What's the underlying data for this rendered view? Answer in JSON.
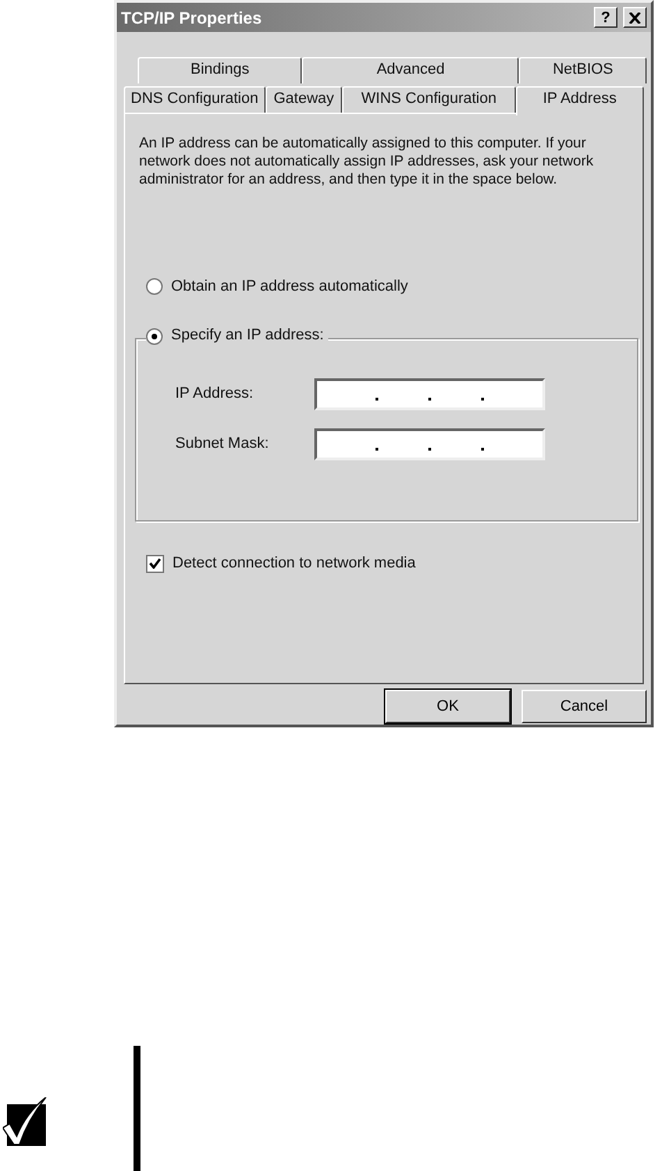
{
  "window": {
    "title": "TCP/IP Properties",
    "help_button": "?"
  },
  "tab_rows": [
    [
      {
        "label": "Bindings",
        "selected": false
      },
      {
        "label": "Advanced",
        "selected": false
      },
      {
        "label": "NetBIOS",
        "selected": false
      }
    ],
    [
      {
        "label": "DNS Configuration",
        "selected": false
      },
      {
        "label": "Gateway",
        "selected": false
      },
      {
        "label": "WINS Configuration",
        "selected": false
      },
      {
        "label": "IP Address",
        "selected": true
      }
    ]
  ],
  "description": "An IP address can be automatically assigned to this computer. If your network does not automatically assign IP addresses, ask your network administrator for an address, and then type it in the space below.",
  "options": [
    {
      "label": "Obtain an IP address automatically",
      "selected": false
    },
    {
      "label": "Specify an IP address:",
      "selected": true
    }
  ],
  "fields": [
    {
      "label": "IP Address:"
    },
    {
      "label": "Subnet Mask:"
    }
  ],
  "checkbox": {
    "label": "Detect connection to network media",
    "checked": true
  },
  "buttons": [
    {
      "label": "OK",
      "default": true
    },
    {
      "label": "Cancel",
      "default": false
    }
  ]
}
